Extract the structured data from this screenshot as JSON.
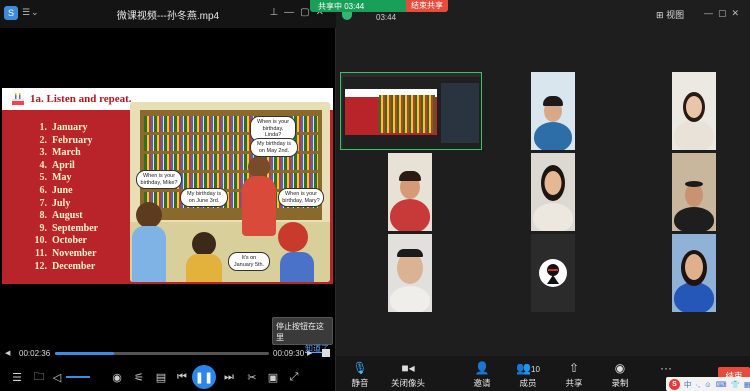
{
  "player": {
    "title": "微课视频---孙冬燕.mp4",
    "logo": "S",
    "menu_icon": "hamburger-icon",
    "slide": {
      "title": "1a. Listen and repeat.",
      "months": [
        {
          "n": "1.",
          "m": "January"
        },
        {
          "n": "2.",
          "m": "February"
        },
        {
          "n": "3.",
          "m": "March"
        },
        {
          "n": "4.",
          "m": "April"
        },
        {
          "n": "5.",
          "m": "May"
        },
        {
          "n": "6.",
          "m": "June"
        },
        {
          "n": "7.",
          "m": "July"
        },
        {
          "n": "8.",
          "m": "August"
        },
        {
          "n": "9.",
          "m": "September"
        },
        {
          "n": "10.",
          "m": "October"
        },
        {
          "n": "11.",
          "m": "November"
        },
        {
          "n": "12.",
          "m": "December"
        }
      ],
      "bubbles": {
        "b1": "When is your birthday, Linda?",
        "b2": "My birthday is on May 2nd.",
        "b3": "When is your birthday, Mike?",
        "b4": "My birthday is on June 3rd.",
        "b5": "When is your birthday, Mary?",
        "b6": "It's on January 5th."
      }
    },
    "stop_tip": {
      "text": "停止按钮在这里",
      "ok": "知道了"
    },
    "current_time": "00:02:36",
    "duration": "00:09:30",
    "progress_fraction": 0.274
  },
  "meeting": {
    "share_status": "共享中 03:44",
    "end_share": "结束共享",
    "timer": "03:44",
    "view_label": "视图",
    "toolbar": {
      "mute": "静音",
      "camera_off": "关闭像头",
      "invite": "邀请",
      "members": "成员",
      "members_count": "10",
      "share": "共享",
      "record": "录制",
      "more": "···"
    },
    "leave": "结束",
    "ime": {
      "mode": "中",
      "sym": "·,",
      "emoji": "☺"
    }
  }
}
